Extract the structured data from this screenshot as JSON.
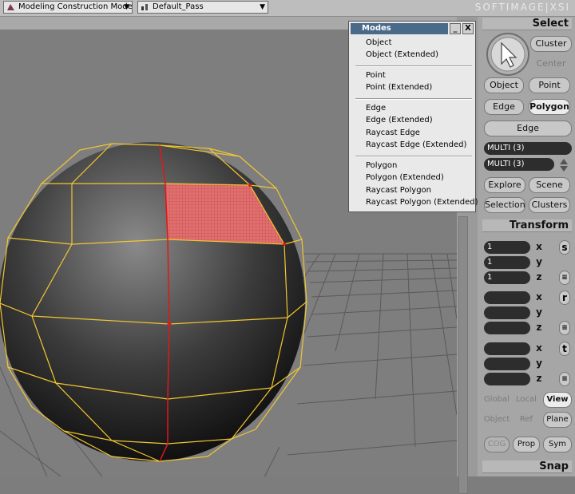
{
  "toolbar": {
    "mode_combo": "Modeling Construction Mode",
    "pass_combo": "Default_Pass",
    "brand": "SOFTIMAGE|XSI"
  },
  "modes_menu": {
    "title": "Modes",
    "minimize": "_",
    "close": "X",
    "items": [
      "Object",
      "Object (Extended)",
      "Point",
      "Point (Extended)",
      "Edge",
      "Edge (Extended)",
      "Raycast Edge",
      "Raycast Edge (Extended)",
      "Polygon",
      "Polygon (Extended)",
      "Raycast Polygon",
      "Raycast Polygon (Extended)"
    ]
  },
  "select_panel": {
    "title": "Select",
    "cluster": "Cluster",
    "center": "Center",
    "object": "Object",
    "point": "Point",
    "edge": "Edge",
    "polygon": "Polygon",
    "edge_dropdown": "Edge",
    "multi1": "MULTI (3)",
    "multi2": "MULTI (3)",
    "explore": "Explore",
    "scene": "Scene",
    "selection": "Selection",
    "clusters": "Clusters"
  },
  "transform_panel": {
    "title": "Transform",
    "scale": {
      "x": "1",
      "y": "1",
      "z": "1",
      "label": "s"
    },
    "rotate": {
      "label": "r"
    },
    "translate": {
      "label": "t"
    },
    "axes": {
      "x": "x",
      "y": "y",
      "z": "z"
    },
    "global": "Global",
    "local": "Local",
    "view": "View",
    "object": "Object",
    "ref": "Ref",
    "plane": "Plane",
    "cog": "COG",
    "prop": "Prop",
    "sym": "Sym"
  },
  "snap_panel": {
    "title": "Snap"
  },
  "colors": {
    "wireframe": "#f2c630",
    "selected_polygon": "#e06a6a",
    "seam": "#e01818",
    "menu_title": "#4a6a8a"
  }
}
